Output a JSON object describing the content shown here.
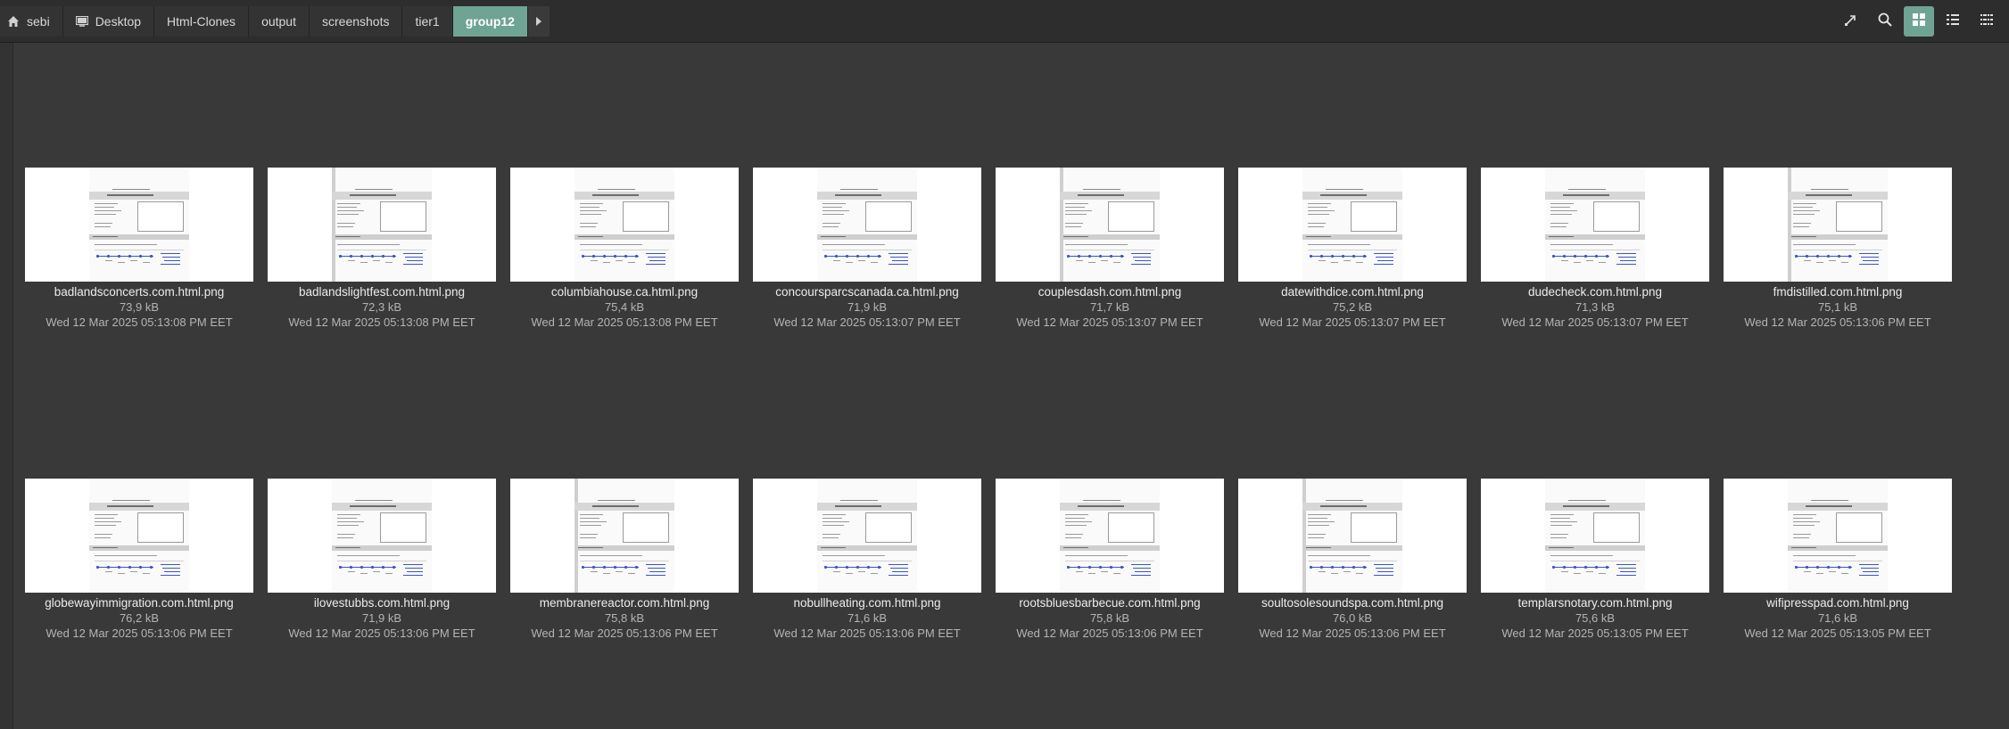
{
  "breadcrumb": {
    "items": [
      {
        "label": "sebi",
        "icon": "home-icon",
        "active": false
      },
      {
        "label": "Desktop",
        "icon": "desktop-icon",
        "active": false
      },
      {
        "label": "Html-Clones",
        "active": false
      },
      {
        "label": "output",
        "active": false
      },
      {
        "label": "screenshots",
        "active": false
      },
      {
        "label": "tier1",
        "active": false
      },
      {
        "label": "group12",
        "active": true
      }
    ],
    "more_icon": "triangle-right-icon"
  },
  "toolbar": {
    "buttons": [
      {
        "name": "location-toggle-button",
        "icon": "location-icon",
        "active": false
      },
      {
        "name": "search-button",
        "icon": "search-icon",
        "active": false
      },
      {
        "name": "icon-view-button",
        "icon": "grid-icon",
        "active": true
      },
      {
        "name": "list-view-button",
        "icon": "list-icon",
        "active": false
      },
      {
        "name": "compact-view-button",
        "icon": "compact-icon",
        "active": false
      }
    ]
  },
  "colors": {
    "accent": "#6fa393",
    "background": "#393939",
    "pathbar": "#2d2d2d"
  },
  "files": [
    {
      "name": "badlandsconcerts.com.html.png",
      "size": "73,9 kB",
      "date": "Wed 12 Mar 2025 05:13:08 PM EET"
    },
    {
      "name": "badlandslightfest.com.html.png",
      "size": "72,3 kB",
      "date": "Wed 12 Mar 2025 05:13:08 PM EET"
    },
    {
      "name": "columbiahouse.ca.html.png",
      "size": "75,4 kB",
      "date": "Wed 12 Mar 2025 05:13:08 PM EET"
    },
    {
      "name": "concoursparcscanada.ca.html.png",
      "size": "71,9 kB",
      "date": "Wed 12 Mar 2025 05:13:07 PM EET"
    },
    {
      "name": "couplesdash.com.html.png",
      "size": "71,7 kB",
      "date": "Wed 12 Mar 2025 05:13:07 PM EET"
    },
    {
      "name": "datewithdice.com.html.png",
      "size": "75,2 kB",
      "date": "Wed 12 Mar 2025 05:13:07 PM EET"
    },
    {
      "name": "dudecheck.com.html.png",
      "size": "71,3 kB",
      "date": "Wed 12 Mar 2025 05:13:07 PM EET"
    },
    {
      "name": "fmdistilled.com.html.png",
      "size": "75,1 kB",
      "date": "Wed 12 Mar 2025 05:13:06 PM EET"
    },
    {
      "name": "globewayimmigration.com.html.png",
      "size": "76,2 kB",
      "date": "Wed 12 Mar 2025 05:13:06 PM EET"
    },
    {
      "name": "ilovestubbs.com.html.png",
      "size": "71,9 kB",
      "date": "Wed 12 Mar 2025 05:13:06 PM EET"
    },
    {
      "name": "membranereactor.com.html.png",
      "size": "75,8 kB",
      "date": "Wed 12 Mar 2025 05:13:06 PM EET"
    },
    {
      "name": "nobullheating.com.html.png",
      "size": "71,6 kB",
      "date": "Wed 12 Mar 2025 05:13:06 PM EET"
    },
    {
      "name": "rootsbluesbarbecue.com.html.png",
      "size": "75,8 kB",
      "date": "Wed 12 Mar 2025 05:13:06 PM EET"
    },
    {
      "name": "soultosolesoundspa.com.html.png",
      "size": "76,0 kB",
      "date": "Wed 12 Mar 2025 05:13:06 PM EET"
    },
    {
      "name": "templarsnotary.com.html.png",
      "size": "75,6 kB",
      "date": "Wed 12 Mar 2025 05:13:05 PM EET"
    },
    {
      "name": "wifipresspad.com.html.png",
      "size": "71,6 kB",
      "date": "Wed 12 Mar 2025 05:13:05 PM EET"
    }
  ]
}
